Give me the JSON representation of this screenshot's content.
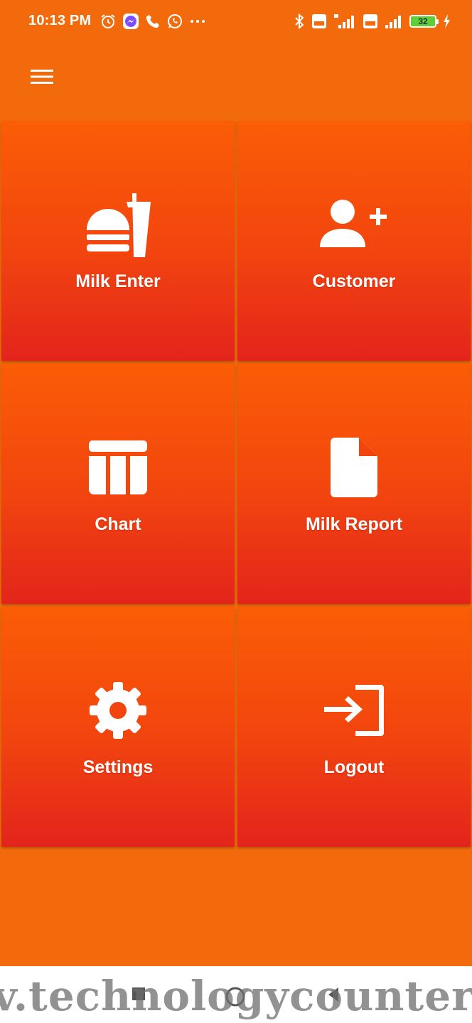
{
  "status_bar": {
    "time": "10:13 PM",
    "left_icons": [
      "alarm-icon",
      "messenger-icon",
      "phone-icon",
      "whatsapp-icon",
      "more-icon"
    ],
    "right_icons": [
      "bluetooth-icon",
      "volte-icon",
      "signal-4g-icon",
      "volte-icon",
      "signal-icon"
    ],
    "battery_level": "32"
  },
  "app_bar": {
    "menu_icon": "hamburger-menu-icon"
  },
  "tiles": [
    {
      "label": "Milk Enter",
      "icon": "food-drink-icon"
    },
    {
      "label": "Customer",
      "icon": "add-user-icon"
    },
    {
      "label": "Chart",
      "icon": "table-chart-icon"
    },
    {
      "label": "Milk Report",
      "icon": "document-icon"
    },
    {
      "label": "Settings",
      "icon": "gear-icon"
    },
    {
      "label": "Logout",
      "icon": "logout-icon"
    }
  ],
  "colors": {
    "background": "#f26a0b",
    "tile_top": "#fb5d06",
    "tile_bottom": "#e3241c",
    "text": "#ffffff"
  },
  "watermark": "v.technologycounter"
}
